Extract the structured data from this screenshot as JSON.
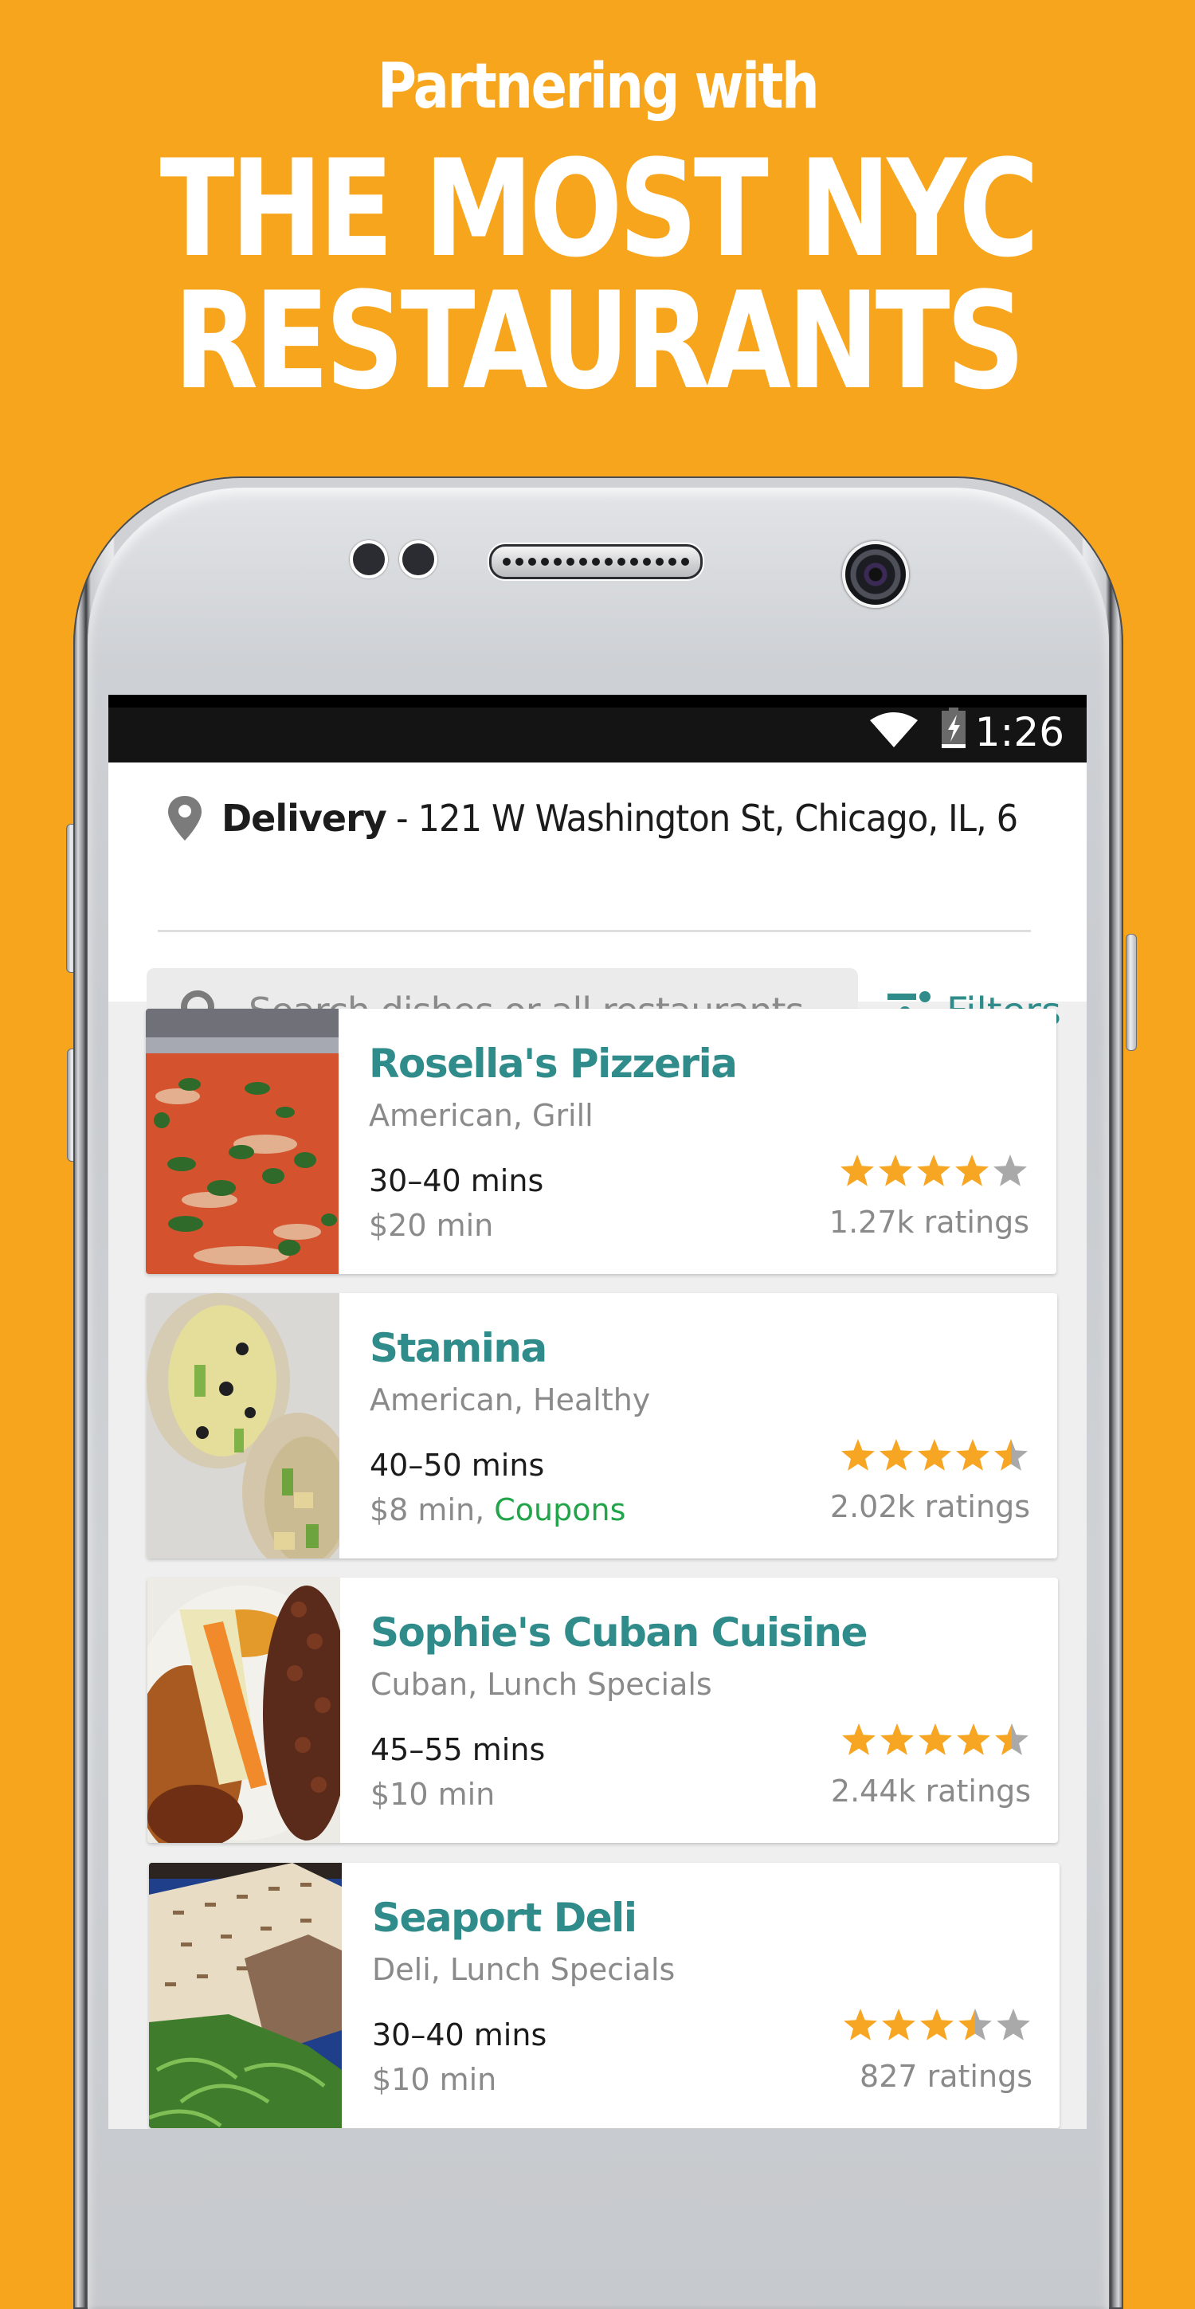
{
  "headline": {
    "subtitle": "Partnering with",
    "line1": "THE MOST NYC",
    "line2": "RESTAURANTS"
  },
  "colors": {
    "background": "#F7A51D",
    "accent_teal": "#2F8C8B",
    "coupon_green": "#22A54A",
    "star_filled": "#F6A623",
    "star_empty": "#A9A9A9"
  },
  "status_bar": {
    "time": "1:26",
    "icons": [
      "wifi-icon",
      "battery-charging-icon"
    ]
  },
  "delivery": {
    "icon": "location-pin-icon",
    "label": "Delivery",
    "address": "- 121 W Washington St, Chicago, IL, 6"
  },
  "search": {
    "icon": "search-icon",
    "placeholder": "Search dishes or all restaurants"
  },
  "filters": {
    "icon": "sliders-icon",
    "label": "Filters"
  },
  "restaurants": [
    {
      "name": "Rosella's Pizzeria",
      "cuisine": "American, Grill",
      "delivery_time": "30–40 mins",
      "minimum": "$20 min",
      "extra": "",
      "rating": 4.0,
      "ratings_count": "1.27k ratings",
      "photo": "pizza"
    },
    {
      "name": "Stamina",
      "cuisine": "American, Healthy",
      "delivery_time": "40–50 mins",
      "minimum": "$8 min,",
      "extra": "Coupons",
      "rating": 4.5,
      "ratings_count": "2.02k ratings",
      "photo": "wrap"
    },
    {
      "name": "Sophie's Cuban Cuisine",
      "cuisine": "Cuban, Lunch Specials",
      "delivery_time": "45–55 mins",
      "minimum": "$10 min",
      "extra": "",
      "rating": 4.5,
      "ratings_count": "2.44k ratings",
      "photo": "cuban-plate"
    },
    {
      "name": "Seaport Deli",
      "cuisine": "Deli, Lunch Specials",
      "delivery_time": "30–40 mins",
      "minimum": "$10 min",
      "extra": "",
      "rating": 3.5,
      "ratings_count": "827 ratings",
      "photo": "panini"
    }
  ]
}
